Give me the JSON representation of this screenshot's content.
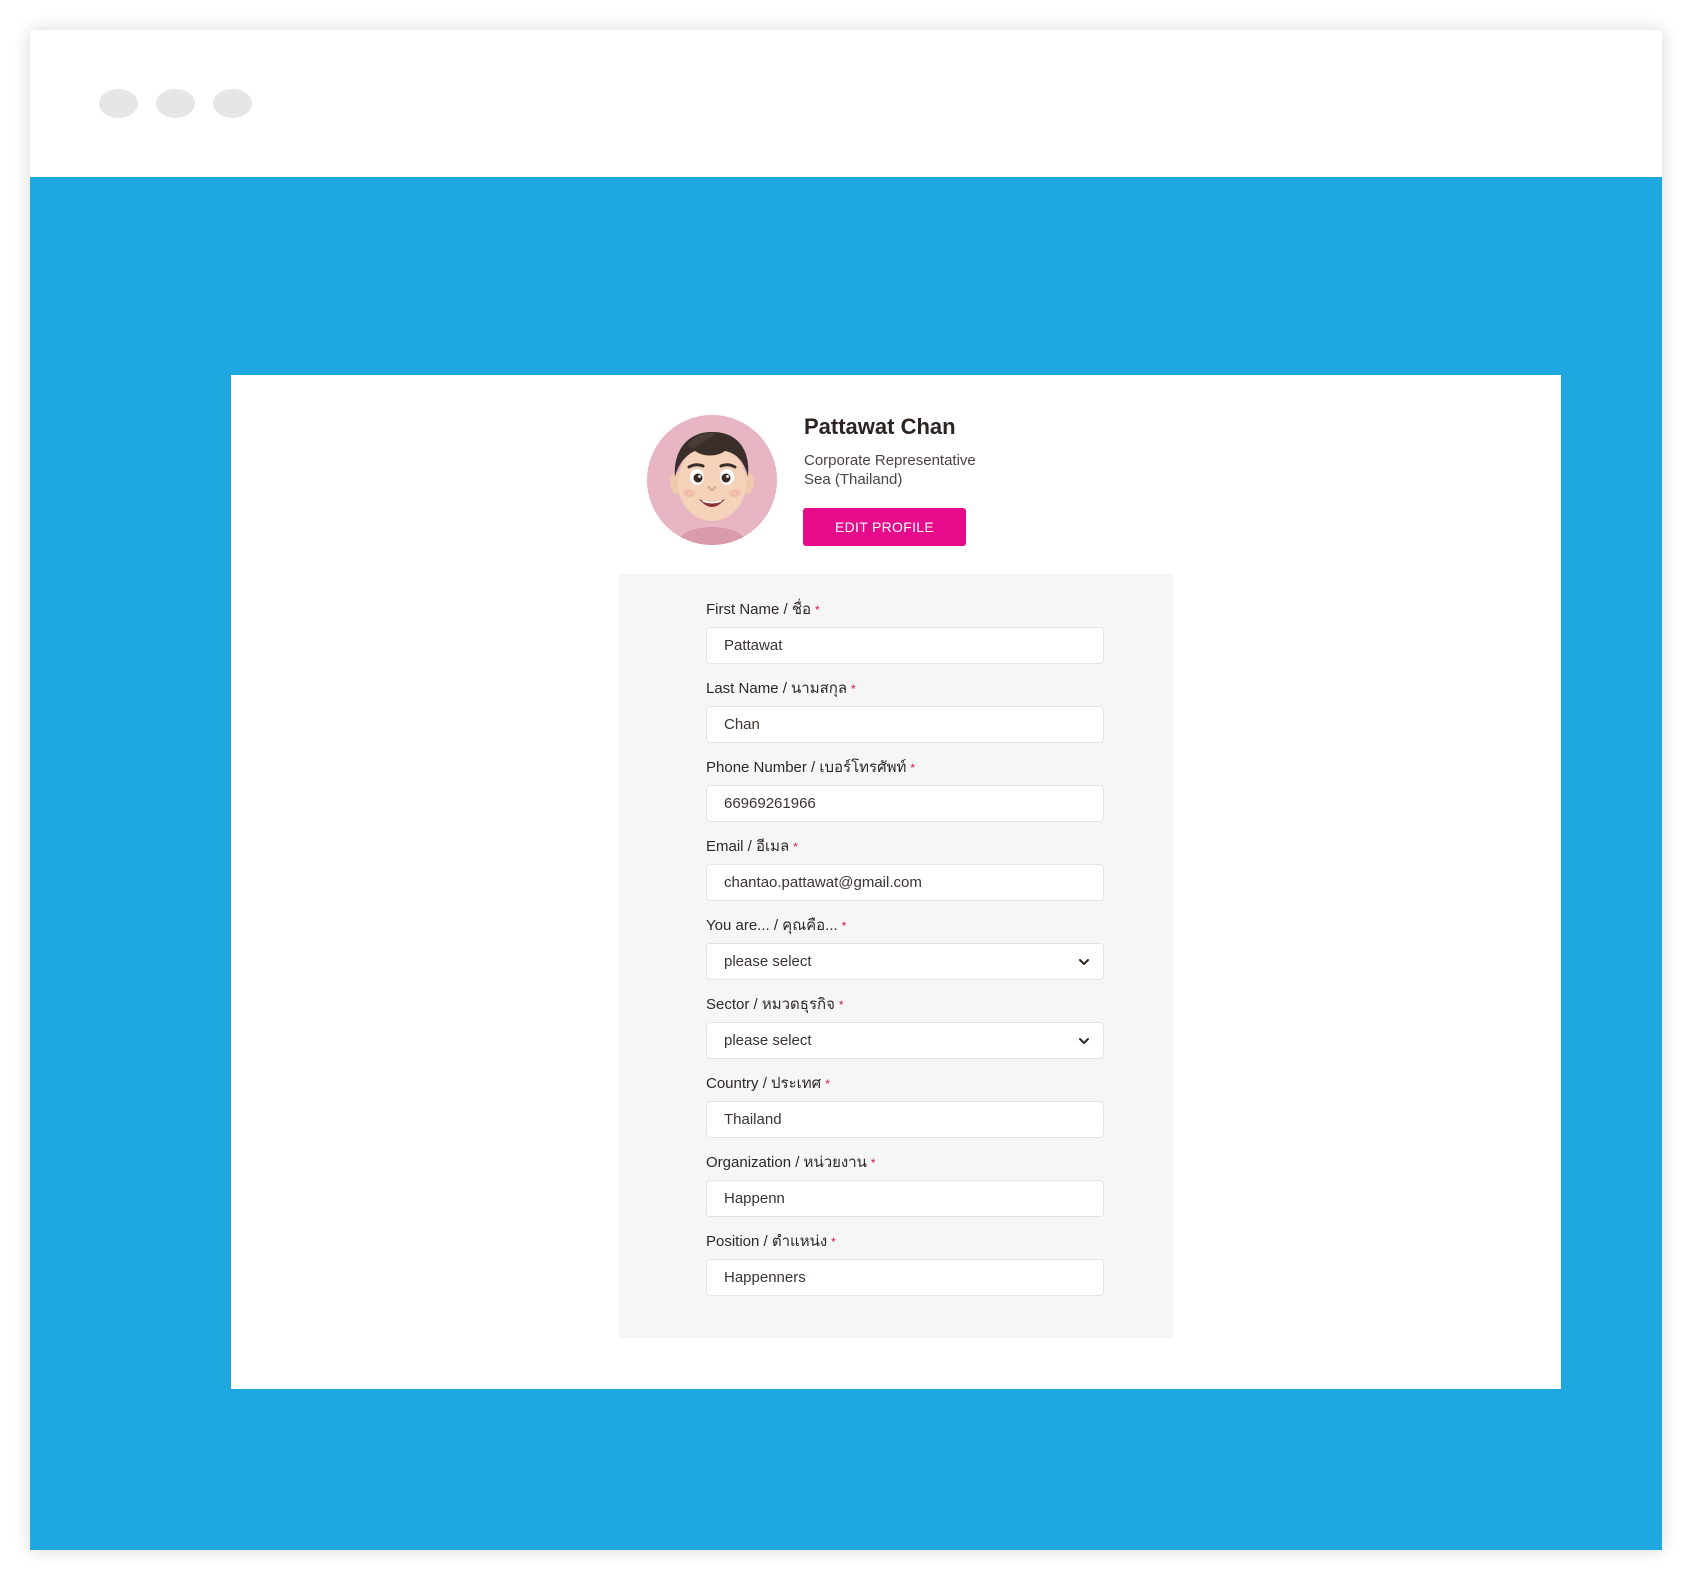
{
  "profile": {
    "name": "Pattawat Chan",
    "role": "Corporate Representative",
    "company": "Sea (Thailand)",
    "edit_button": "EDIT PROFILE"
  },
  "form": {
    "fields": [
      {
        "label": "First Name / ชื่อ",
        "required": "*",
        "value": "Pattawat",
        "type": "text"
      },
      {
        "label": "Last Name / นามสกุล",
        "required": "*",
        "value": "Chan",
        "type": "text"
      },
      {
        "label": "Phone Number / เบอร์โทรศัพท์",
        "required": "*",
        "value": "66969261966",
        "type": "text"
      },
      {
        "label": "Email / อีเมล",
        "required": "*",
        "value": "chantao.pattawat@gmail.com",
        "type": "text"
      },
      {
        "label": "You are... / คุณคือ...",
        "required": "*",
        "value": "please select",
        "type": "select"
      },
      {
        "label": "Sector / หมวดธุรกิจ",
        "required": "*",
        "value": "please select",
        "type": "select"
      },
      {
        "label": "Country / ประเทศ",
        "required": "*",
        "value": "Thailand",
        "type": "text"
      },
      {
        "label": "Organization / หน่วยงาน",
        "required": "*",
        "value": "Happenn",
        "type": "text"
      },
      {
        "label": "Position / ตำแหน่ง",
        "required": "*",
        "value": "Happenners",
        "type": "text"
      }
    ]
  },
  "icons": {
    "window_controls": [
      "window-dot",
      "window-dot",
      "window-dot"
    ],
    "select_indicator": "chevron-down-icon",
    "avatar": "memoji-avatar"
  },
  "colors": {
    "viewport_background": "#1fa7df",
    "accent": "#e50b8a",
    "required_mark": "#d1174f",
    "form_panel": "#f6f6f6",
    "avatar_background": "#e8b6c2"
  }
}
